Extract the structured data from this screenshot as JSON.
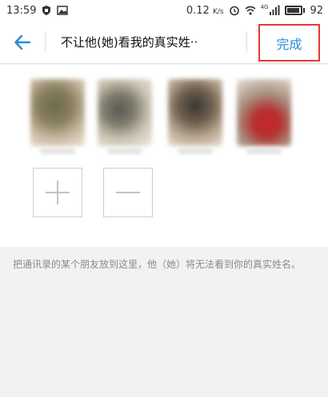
{
  "status_bar": {
    "time": "13:59",
    "speed": "0.12",
    "speed_unit": "K/s",
    "network_tag": "4G",
    "battery": "92",
    "battery_level": 0.92
  },
  "header": {
    "title": "不让他(她)看我的真实姓··",
    "done_label": "完成"
  },
  "members": {
    "add_symbol": "+",
    "remove_symbol": "—"
  },
  "description": "把通讯录的某个朋友放到这里，他（她）将无法看到你的真实姓名。",
  "colors": {
    "accent": "#2a8ad4",
    "highlight_box": "#e53935",
    "background": "#f2f2f2",
    "description_text": "#8a8a8a"
  },
  "icons": {
    "back": "arrow-left-icon",
    "add": "plus-icon",
    "remove": "minus-icon",
    "wifi": "wifi-icon",
    "alarm": "alarm-icon",
    "signal": "signal-icon",
    "battery": "battery-icon",
    "shield": "shield-icon",
    "image": "image-icon"
  }
}
